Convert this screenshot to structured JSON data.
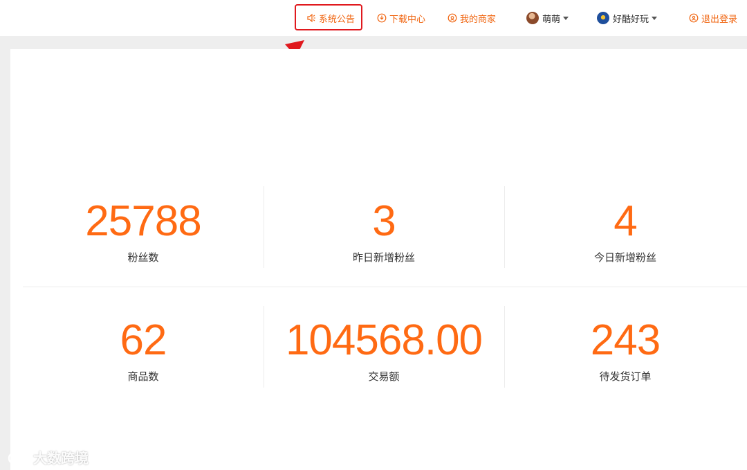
{
  "nav": {
    "notice": "系统公告",
    "download": "下载中心",
    "merchant": "我的商家",
    "user": "萌萌",
    "shop": "好酷好玩",
    "logout": "退出登录"
  },
  "stats": [
    {
      "value": "25788",
      "label": "粉丝数"
    },
    {
      "value": "3",
      "label": "昨日新增粉丝"
    },
    {
      "value": "4",
      "label": "今日新增粉丝"
    },
    {
      "value": "62",
      "label": "商品数"
    },
    {
      "value": "104568.00",
      "label": "交易额"
    },
    {
      "value": "243",
      "label": "待发货订单"
    }
  ],
  "watermark": "大数跨境",
  "colors": {
    "accent": "#f0640f",
    "value": "#ff6a13",
    "highlight": "#e0191e"
  }
}
